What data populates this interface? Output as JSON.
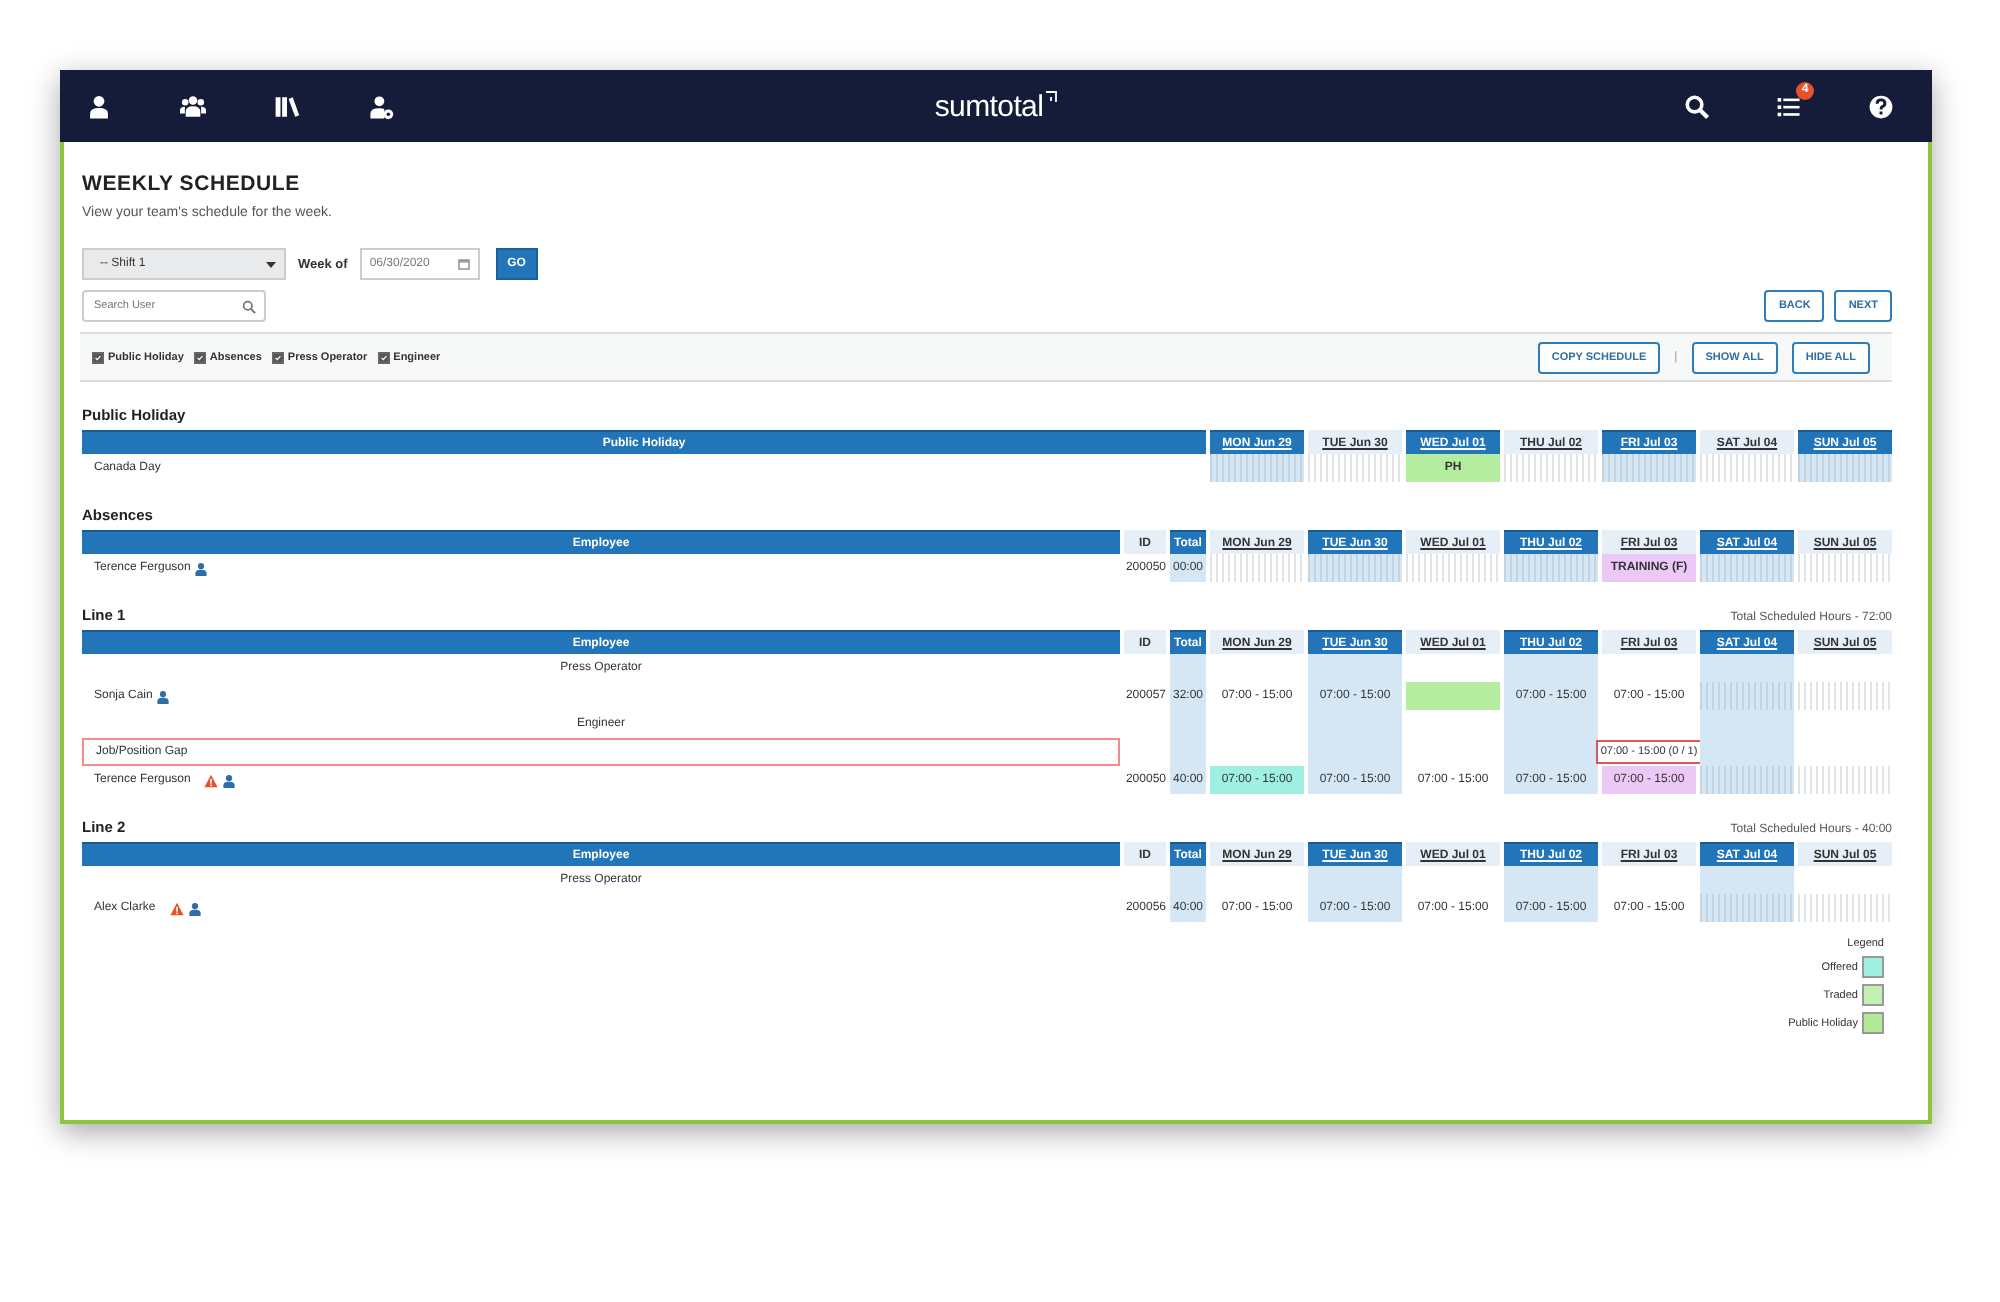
{
  "nav": {
    "logo": "sumtotal",
    "notifications_badge": "4"
  },
  "header": {
    "title": "WEEKLY SCHEDULE",
    "subtitle": "View your team's schedule for the week."
  },
  "controls": {
    "shift_select": "-- Shift 1",
    "week_label": "Week of",
    "week_field": "06/30/2020",
    "go_button": "GO",
    "search": {
      "placeholder": "Search User"
    },
    "back_button": "BACK",
    "next_button": "NEXT"
  },
  "filters": [
    {
      "label": "Public Holiday",
      "checked": true
    },
    {
      "label": "Absences",
      "checked": true
    },
    {
      "label": "Press Operator",
      "checked": true
    },
    {
      "label": "Engineer",
      "checked": true
    }
  ],
  "actions": {
    "copy_button": "COPY SCHEDULE",
    "separator": "|",
    "show_all_button": "SHOW ALL",
    "hide_all_button": "HIDE ALL"
  },
  "sections": [
    {
      "title": "Public Holiday",
      "kind": "holiday",
      "columns": {
        "name": "Public Holiday"
      },
      "days": [
        {
          "label": "MON Jun 29",
          "highlighted": true
        },
        {
          "label": "TUE Jun 30",
          "highlighted": false
        },
        {
          "label": "WED Jul 01",
          "highlighted": true
        },
        {
          "label": "THU Jul 02",
          "highlighted": false
        },
        {
          "label": "FRI Jul 03",
          "highlighted": true
        },
        {
          "label": "SAT Jul 04",
          "highlighted": false
        },
        {
          "label": "SUN Jul 05",
          "highlighted": true
        }
      ],
      "rows": [
        {
          "kind": "entry",
          "name": "Canada Day",
          "cells": [
            {
              "kind": "empty"
            },
            {
              "kind": "empty"
            },
            {
              "kind": "badge",
              "text": "PH",
              "color": "#b4eca0"
            },
            {
              "kind": "empty"
            },
            {
              "kind": "empty"
            },
            {
              "kind": "empty"
            },
            {
              "kind": "empty"
            }
          ]
        }
      ]
    },
    {
      "title": "Absences",
      "kind": "roster",
      "columns": {
        "name": "Employee",
        "id": "ID",
        "total": "Total"
      },
      "days": [
        {
          "label": "MON Jun 29",
          "highlighted": false
        },
        {
          "label": "TUE Jun 30",
          "highlighted": true
        },
        {
          "label": "WED Jul 01",
          "highlighted": false
        },
        {
          "label": "THU Jul 02",
          "highlighted": true
        },
        {
          "label": "FRI Jul 03",
          "highlighted": false
        },
        {
          "label": "SAT Jul 04",
          "highlighted": true
        },
        {
          "label": "SUN Jul 05",
          "highlighted": false
        }
      ],
      "rows": [
        {
          "kind": "employee",
          "name": "Terence Ferguson",
          "warning": false,
          "id": "200050",
          "total": "00:00",
          "cells": [
            {
              "kind": "empty"
            },
            {
              "kind": "empty"
            },
            {
              "kind": "empty"
            },
            {
              "kind": "empty"
            },
            {
              "kind": "badge",
              "text": "TRAINING (F)",
              "color": "#ebc8f5"
            },
            {
              "kind": "empty"
            },
            {
              "kind": "empty"
            }
          ]
        }
      ]
    },
    {
      "title": "Line 1",
      "kind": "roster",
      "total_label": "Total Scheduled Hours - 72:00",
      "columns": {
        "name": "Employee",
        "id": "ID",
        "total": "Total"
      },
      "days": [
        {
          "label": "MON Jun 29",
          "highlighted": false
        },
        {
          "label": "TUE Jun 30",
          "highlighted": true
        },
        {
          "label": "WED Jul 01",
          "highlighted": false
        },
        {
          "label": "THU Jul 02",
          "highlighted": true
        },
        {
          "label": "FRI Jul 03",
          "highlighted": false
        },
        {
          "label": "SAT Jul 04",
          "highlighted": true
        },
        {
          "label": "SUN Jul 05",
          "highlighted": false
        }
      ],
      "rows": [
        {
          "kind": "role",
          "name": "Press Operator"
        },
        {
          "kind": "employee",
          "name": "Sonja Cain",
          "warning": false,
          "id": "200057",
          "total": "32:00",
          "cells": [
            {
              "kind": "shift",
              "text": "07:00 - 15:00"
            },
            {
              "kind": "shift",
              "text": "07:00 - 15:00"
            },
            {
              "kind": "fill",
              "color": "#b4eca0"
            },
            {
              "kind": "shift",
              "text": "07:00 - 15:00"
            },
            {
              "kind": "shift",
              "text": "07:00 - 15:00"
            },
            {
              "kind": "empty"
            },
            {
              "kind": "empty"
            }
          ]
        },
        {
          "kind": "role",
          "name": "Engineer"
        },
        {
          "kind": "gap",
          "name": "Job/Position Gap",
          "cells": [
            {
              "kind": "blank"
            },
            {
              "kind": "blank"
            },
            {
              "kind": "blank"
            },
            {
              "kind": "blank"
            },
            {
              "kind": "gap",
              "text": "07:00 - 15:00 (0 / 1)"
            },
            {
              "kind": "blank"
            },
            {
              "kind": "blank"
            }
          ]
        },
        {
          "kind": "employee",
          "name": "Terence Ferguson",
          "warning": true,
          "id": "200050",
          "total": "40:00",
          "cells": [
            {
              "kind": "tag",
              "text": "07:00 - 15:00",
              "color": "#9ff0e2"
            },
            {
              "kind": "shift",
              "text": "07:00 - 15:00"
            },
            {
              "kind": "shift",
              "text": "07:00 - 15:00"
            },
            {
              "kind": "shift",
              "text": "07:00 - 15:00"
            },
            {
              "kind": "tag",
              "text": "07:00 - 15:00",
              "color": "#ebc8f5"
            },
            {
              "kind": "empty"
            },
            {
              "kind": "empty"
            }
          ]
        }
      ]
    },
    {
      "title": "Line 2",
      "kind": "roster",
      "total_label": "Total Scheduled Hours - 40:00",
      "columns": {
        "name": "Employee",
        "id": "ID",
        "total": "Total"
      },
      "days": [
        {
          "label": "MON Jun 29",
          "highlighted": false
        },
        {
          "label": "TUE Jun 30",
          "highlighted": true
        },
        {
          "label": "WED Jul 01",
          "highlighted": false
        },
        {
          "label": "THU Jul 02",
          "highlighted": true
        },
        {
          "label": "FRI Jul 03",
          "highlighted": false
        },
        {
          "label": "SAT Jul 04",
          "highlighted": true
        },
        {
          "label": "SUN Jul 05",
          "highlighted": false
        }
      ],
      "rows": [
        {
          "kind": "role",
          "name": "Press Operator"
        },
        {
          "kind": "employee",
          "name": "Alex Clarke",
          "warning": true,
          "id": "200056",
          "total": "40:00",
          "cells": [
            {
              "kind": "shift",
              "text": "07:00 - 15:00"
            },
            {
              "kind": "shift",
              "text": "07:00 - 15:00"
            },
            {
              "kind": "shift",
              "text": "07:00 - 15:00"
            },
            {
              "kind": "shift",
              "text": "07:00 - 15:00"
            },
            {
              "kind": "shift",
              "text": "07:00 - 15:00"
            },
            {
              "kind": "empty"
            },
            {
              "kind": "empty"
            }
          ]
        }
      ]
    }
  ],
  "legend": {
    "title": "Legend",
    "items": [
      {
        "label": "Offered",
        "color": "#9ff0e2"
      },
      {
        "label": "Traded",
        "color": "#c2f0b4"
      },
      {
        "label": "Public Holiday",
        "color": "#b0e894"
      }
    ]
  }
}
